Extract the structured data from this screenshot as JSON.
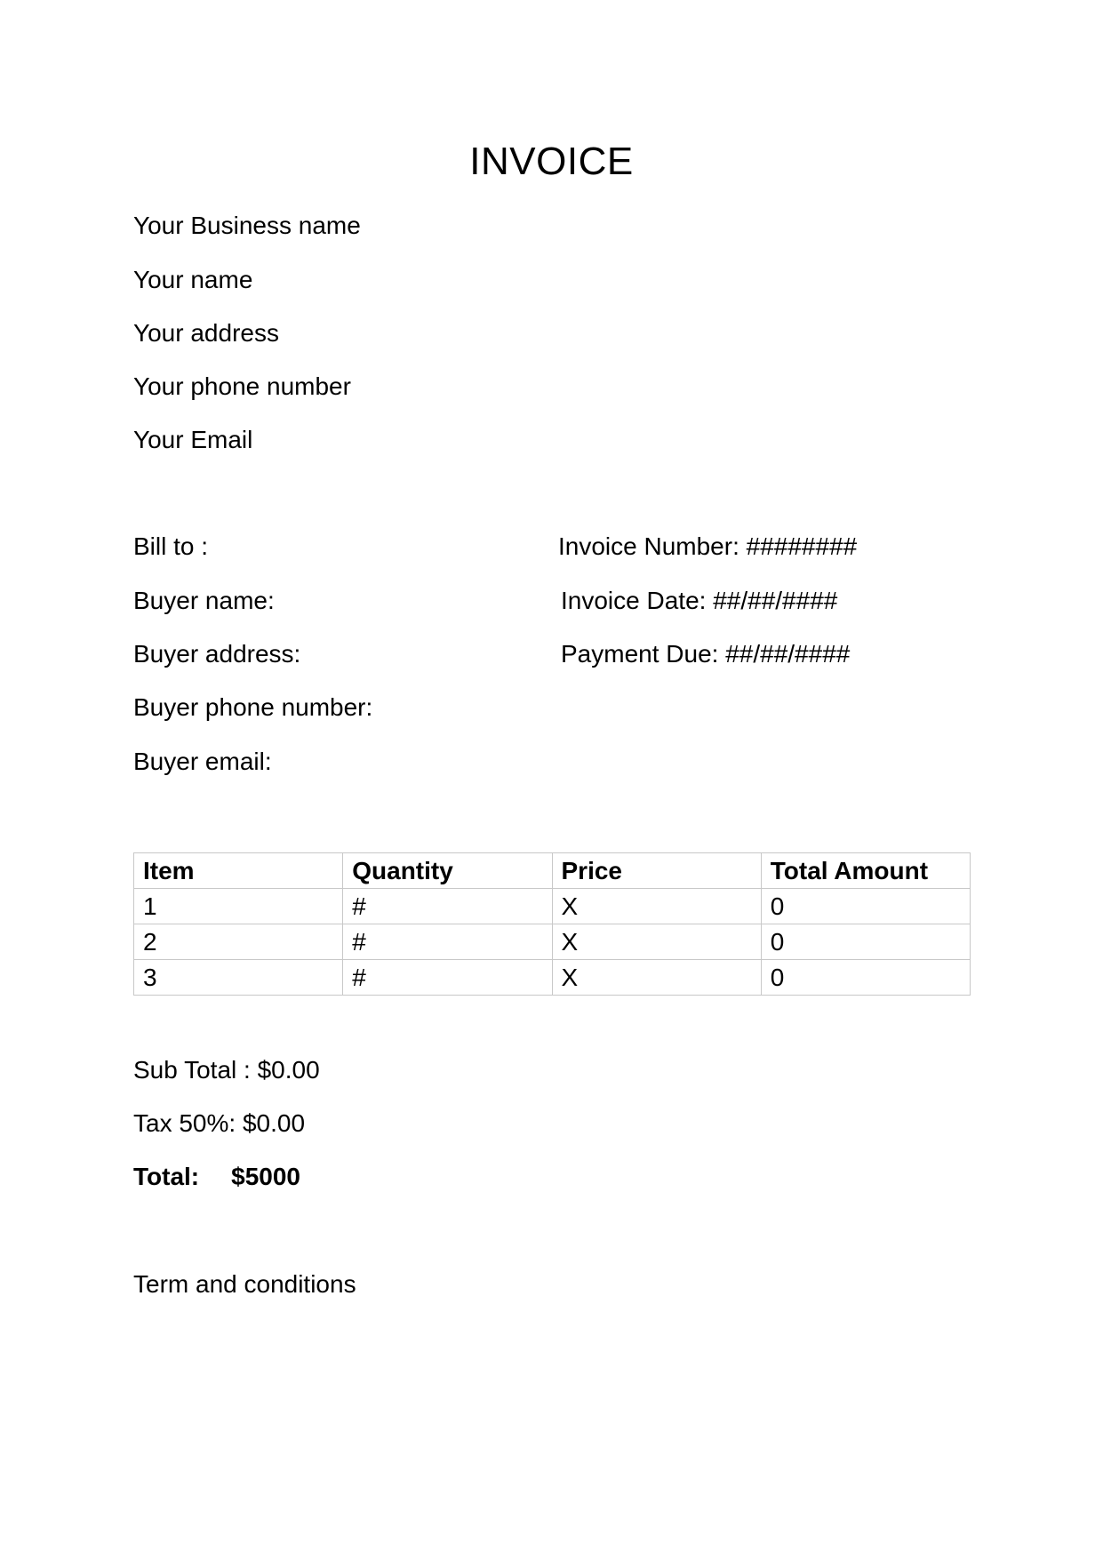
{
  "title": "INVOICE",
  "seller": {
    "business_name": "Your Business name",
    "name": "Your name",
    "address": "Your address",
    "phone": "Your phone number",
    "email": "Your Email"
  },
  "bill_to": {
    "heading": "Bill to :",
    "buyer_name": "Buyer name:",
    "buyer_address": "Buyer address:",
    "buyer_phone": "Buyer phone number:",
    "buyer_email": "Buyer email:"
  },
  "invoice_meta": {
    "number": "Invoice Number: ########",
    "date": "Invoice Date: ##/##/####",
    "payment_due": "Payment Due: ##/##/####"
  },
  "table": {
    "headers": [
      "Item",
      "Quantity",
      "Price",
      "Total Amount"
    ],
    "rows": [
      [
        "1",
        "#",
        "X",
        "0"
      ],
      [
        "2",
        "#",
        "X",
        "0"
      ],
      [
        "3",
        "#",
        "X",
        "0"
      ]
    ]
  },
  "totals": {
    "subtotal": "Sub Total : $0.00",
    "tax": "Tax 50%: $0.00",
    "total_label": "Total:",
    "total_value": "$5000"
  },
  "terms": "Term and conditions"
}
